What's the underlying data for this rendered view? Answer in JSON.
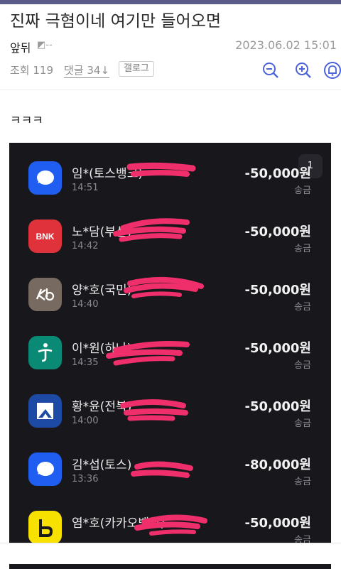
{
  "post": {
    "title": "진짜 극혐이네 여기만 들어오면",
    "author": "앞뒤",
    "author_badge": "--",
    "date": "2023.06.02 15:01",
    "views": "조회 119",
    "comments": "댓글 34",
    "gallog": "갤로그",
    "body": "ㅋㅋㅋ"
  },
  "screenshot": {
    "page_indicator": "1",
    "transactions": [
      {
        "name": "임*(토스뱅크)",
        "time": "14:51",
        "amount": "-50,000원",
        "type": "송금",
        "bank": "toss",
        "color": "#1f5ef0"
      },
      {
        "name": "노*담(부산)",
        "time": "14:42",
        "amount": "-50,000원",
        "type": "송금",
        "bank": "bnk",
        "color": "#e0323a"
      },
      {
        "name": "양*호(국민)",
        "time": "14:40",
        "amount": "-50,000원",
        "type": "송금",
        "bank": "kb",
        "color": "#776b61"
      },
      {
        "name": "이*원(하나)",
        "time": "14:35",
        "amount": "-50,000원",
        "type": "송금",
        "bank": "hana",
        "color": "#0a8a74"
      },
      {
        "name": "황*윤(전북)",
        "time": "14:00",
        "amount": "-50,000원",
        "type": "송금",
        "bank": "jb",
        "color": "#1c4aa5"
      },
      {
        "name": "김*섭(토스)",
        "time": "13:36",
        "amount": "-80,000원",
        "type": "송금",
        "bank": "toss",
        "color": "#1f5ef0"
      },
      {
        "name": "염*호(카카오뱅크)",
        "time": "",
        "amount": "-50,000원",
        "type": "송금",
        "bank": "kakao",
        "color": "#f7e100"
      }
    ]
  },
  "icons": {
    "zoom_out": "zoom-out-icon",
    "zoom_in": "zoom-in-icon",
    "bell": "bell-icon"
  },
  "colors": {
    "redaction": "#ee2f6b",
    "screenshot_bg": "#17171c"
  }
}
